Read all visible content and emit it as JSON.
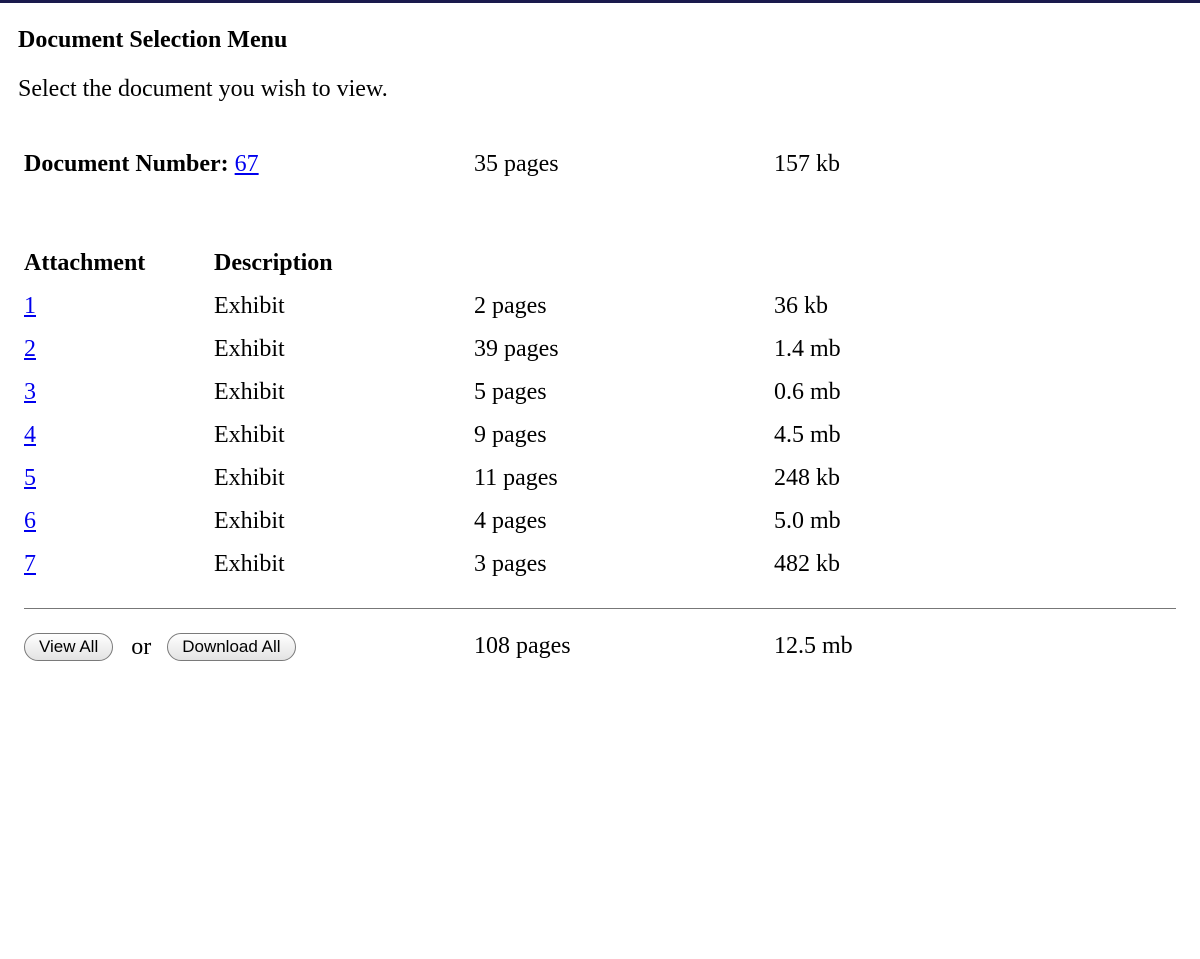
{
  "title": "Document Selection Menu",
  "instruction": "Select the document you wish to view.",
  "doc": {
    "label": "Document Number:",
    "number": "67",
    "pages": "35 pages",
    "size": "157 kb"
  },
  "headers": {
    "attachment": "Attachment",
    "description": "Description"
  },
  "attachments": [
    {
      "num": "1",
      "desc": "Exhibit",
      "pages": "2 pages",
      "size": "36 kb"
    },
    {
      "num": "2",
      "desc": "Exhibit",
      "pages": "39 pages",
      "size": "1.4 mb"
    },
    {
      "num": "3",
      "desc": "Exhibit",
      "pages": "5 pages",
      "size": "0.6 mb"
    },
    {
      "num": "4",
      "desc": "Exhibit",
      "pages": "9 pages",
      "size": "4.5 mb"
    },
    {
      "num": "5",
      "desc": "Exhibit",
      "pages": "11 pages",
      "size": "248 kb"
    },
    {
      "num": "6",
      "desc": "Exhibit",
      "pages": "4 pages",
      "size": "5.0 mb"
    },
    {
      "num": "7",
      "desc": "Exhibit",
      "pages": "3 pages",
      "size": "482 kb"
    }
  ],
  "footer": {
    "view_all": "View All",
    "or": "or",
    "download_all": "Download All",
    "total_pages": "108 pages",
    "total_size": "12.5 mb"
  }
}
